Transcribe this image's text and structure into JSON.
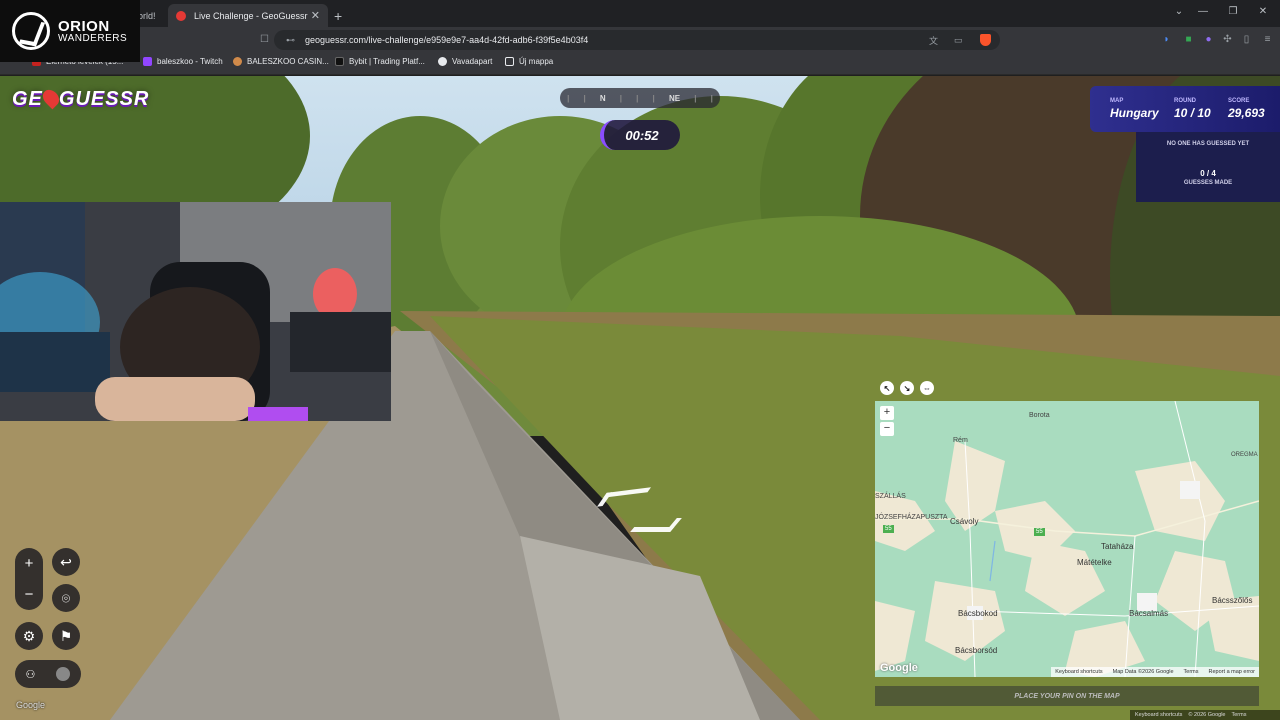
{
  "browser": {
    "tabs": [
      {
        "label": "orld!",
        "active": false
      },
      {
        "label": "Live Challenge - GeoGuessr",
        "active": true
      }
    ],
    "url": "geoguessr.com/live-challenge/e959e9e7-aa4d-42fd-adb6-f39f5e4b03f4",
    "bookmarks": [
      {
        "label": "Elérhető levelek (15..."
      },
      {
        "label": "baleszkoo - Twitch"
      },
      {
        "label": "BALESZKOO CASIN..."
      },
      {
        "label": "Bybit | Trading Platf..."
      },
      {
        "label": "Vavadapart"
      },
      {
        "label": "Új mappa"
      }
    ]
  },
  "overlay": {
    "brand_line1": "ORION",
    "brand_line2": "WANDERERS"
  },
  "game": {
    "logo": "GEOGUESSR",
    "compass": [
      "N",
      "NE"
    ],
    "timer": "00:52",
    "status": {
      "map_label": "MAP",
      "map_value": "Hungary",
      "round_label": "ROUND",
      "round_value": "10 / 10",
      "score_label": "SCORE",
      "score_value": "29,693"
    },
    "no_guess": "NO ONE HAS GUESSED YET",
    "guesses_count": "0 / 4",
    "guesses_label": "GUESSES MADE",
    "place_pin": "PLACE YOUR PIN ON THE MAP",
    "sv_google": "Google",
    "sv_footer": [
      "Keyboard shortcuts",
      "© 2026 Google",
      "Terms"
    ]
  },
  "map": {
    "towns": [
      "Borota",
      "Rém",
      "SZÁLLÁS",
      "JÓZSEFHÁZAPUSZTA",
      "Csávoly",
      "OREGMA",
      "Tataháza",
      "Mátételke",
      "Bácsbokod",
      "Bácsalmás",
      "Bácsszőlős",
      "Bácsborsód"
    ],
    "road_badge": "55",
    "google": "Google",
    "footer": [
      "Keyboard shortcuts",
      "Map Data ©2026 Google",
      "Terms",
      "Report a map error"
    ]
  },
  "colors": {
    "accent_purple": "#8a4dff",
    "status_bg": "#2f2f8f",
    "map_green": "#a9dcbf",
    "map_field": "#efe8d4"
  }
}
